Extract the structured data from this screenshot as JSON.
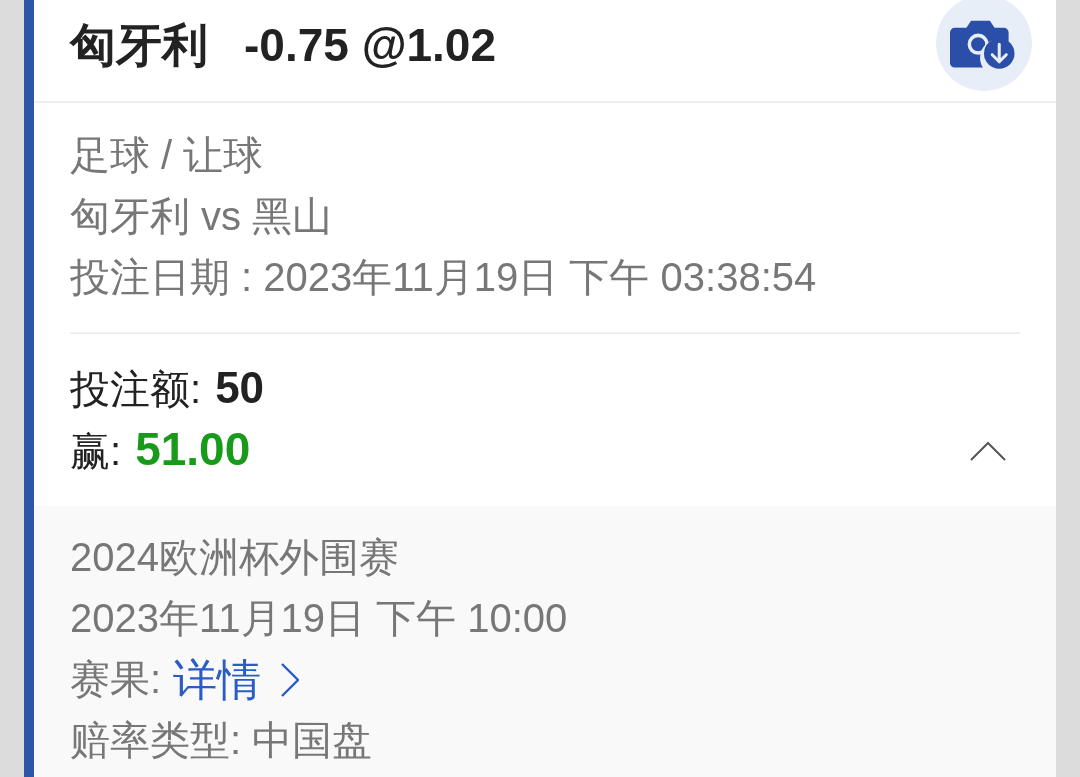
{
  "header": {
    "team": "匈牙利",
    "odds": "-0.75 @1.02"
  },
  "details": [
    "足球 / 让球",
    "匈牙利 vs 黑山",
    "投注日期 : 2023年11月19日 下午 03:38:54"
  ],
  "stake": {
    "label": "投注额:",
    "value": "50"
  },
  "win": {
    "label": "赢:",
    "value": "51.00"
  },
  "expanded": true,
  "match": {
    "competition": "2024欧洲杯外围赛",
    "kickoff": "2023年11月19日 下午 10:00",
    "result": {
      "label": "赛果:",
      "link": "详情"
    },
    "odds_type": "赔率类型: 中国盘"
  }
}
